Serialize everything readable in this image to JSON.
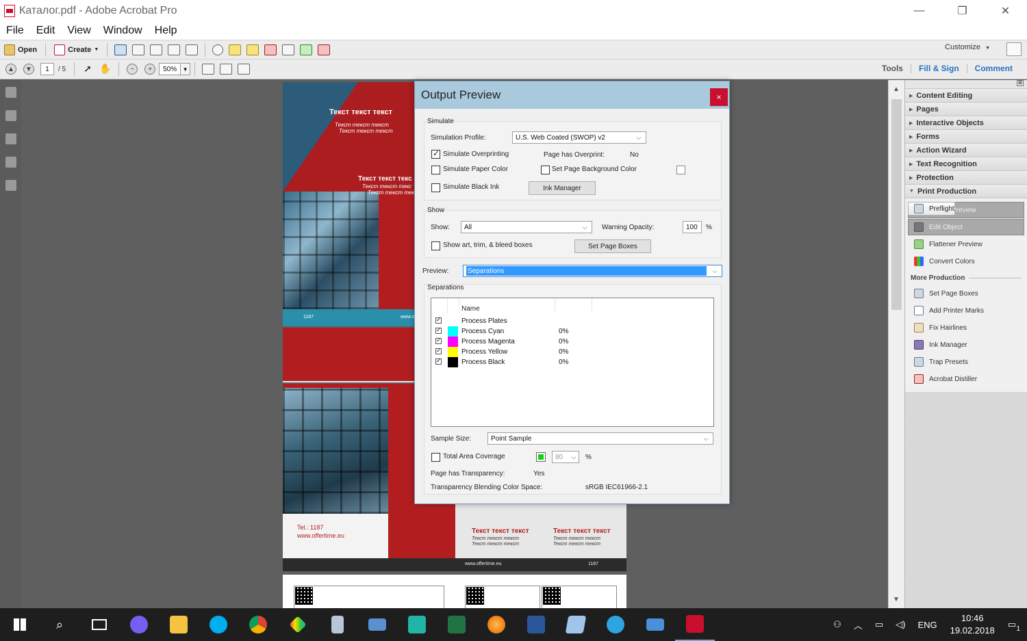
{
  "window": {
    "title": "Каталог.pdf - Adobe Acrobat Pro",
    "minimize": "—",
    "restore": "❐",
    "close": "✕"
  },
  "menu": [
    "File",
    "Edit",
    "View",
    "Window",
    "Help"
  ],
  "toolbar": {
    "open_label": "Open",
    "create_label": "Create",
    "customize_label": "Customize",
    "page_current": "1",
    "page_total": "/ 5",
    "zoom": "50%",
    "tabs": [
      "Tools",
      "Fill & Sign",
      "Comment"
    ]
  },
  "document": {
    "p1_title1": "Текст текст текст",
    "p1_sub1a": "Текст текст текст",
    "p1_sub1b": "Текст текст текст",
    "p1_title2": "Текст текст текс",
    "p1_sub2a": "Текст текст текс",
    "p1_sub2b": "Текст текст текс",
    "p1_footer_left": "1187",
    "p1_footer_right": "www.of",
    "p3_tel": "Tel.: 1187",
    "p3_web": "www.offertime.eu",
    "p3_title_a": "Текст текст текст",
    "p3_title_b": "Текст текст текст",
    "p3_sub_a1": "Текст текст текст",
    "p3_sub_a2": "Текст текст текст",
    "p3_sub_b1": "Текст текст текст",
    "p3_sub_b2": "Текст текст текст",
    "p3_bar_web": "www.offertime.eu",
    "p3_bar_num": "1187"
  },
  "right_panel": {
    "sections": [
      "Content Editing",
      "Pages",
      "Interactive Objects",
      "Forms",
      "Action Wizard",
      "Text Recognition",
      "Protection",
      "Print Production"
    ],
    "print_production_items": [
      "Preflight",
      "Output Preview",
      "Edit Object",
      "Flattener Preview",
      "Convert Colors"
    ],
    "more_production_label": "More Production",
    "more_items": [
      "Set Page Boxes",
      "Add Printer Marks",
      "Fix Hairlines",
      "Ink Manager",
      "Trap Presets",
      "Acrobat Distiller"
    ]
  },
  "dialog": {
    "title": "Output Preview",
    "close": "×",
    "simulate_label": "Simulate",
    "simulation_profile_label": "Simulation Profile:",
    "simulation_profile_value": "U.S. Web Coated (SWOP) v2",
    "simulate_overprinting": "Simulate Overprinting",
    "page_has_overprint_label": "Page has Overprint:",
    "page_has_overprint_value": "No",
    "simulate_paper_color": "Simulate Paper Color",
    "set_page_bg_color": "Set Page Background Color",
    "simulate_black_ink": "Simulate Black Ink",
    "ink_manager_btn": "Ink Manager",
    "show_group_label": "Show",
    "show_label": "Show:",
    "show_value": "All",
    "warning_opacity_label": "Warning Opacity:",
    "warning_opacity_value": "100",
    "percent": "%",
    "show_boxes_label": "Show art, trim, & bleed boxes",
    "set_page_boxes_btn": "Set Page Boxes",
    "preview_label": "Preview:",
    "preview_value": "Separations",
    "separations_label": "Separations",
    "name_col": "Name",
    "separations": [
      {
        "name": "Process Plates",
        "pct": "",
        "color": ""
      },
      {
        "name": "Process Cyan",
        "pct": "0%",
        "color": "#00ffff"
      },
      {
        "name": "Process Magenta",
        "pct": "0%",
        "color": "#ff00ff"
      },
      {
        "name": "Process Yellow",
        "pct": "0%",
        "color": "#ffff00"
      },
      {
        "name": "Process Black",
        "pct": "0%",
        "color": "#000000"
      }
    ],
    "sample_size_label": "Sample Size:",
    "sample_size_value": "Point Sample",
    "total_area_coverage": "Total Area Coverage",
    "coverage_value": "80",
    "page_transparency_label": "Page has Transparency:",
    "page_transparency_value": "Yes",
    "blending_space_label": "Transparency Blending Color Space:",
    "blending_space_value": "sRGB IEC61966-2.1"
  },
  "taskbar": {
    "lang": "ENG",
    "time": "10:46",
    "date": "19.02.2018",
    "notif_count": "1"
  },
  "colors": {
    "accent": "#2873c2",
    "dialog_title_bg": "#a9c9dc",
    "close_red": "#c8102e"
  }
}
